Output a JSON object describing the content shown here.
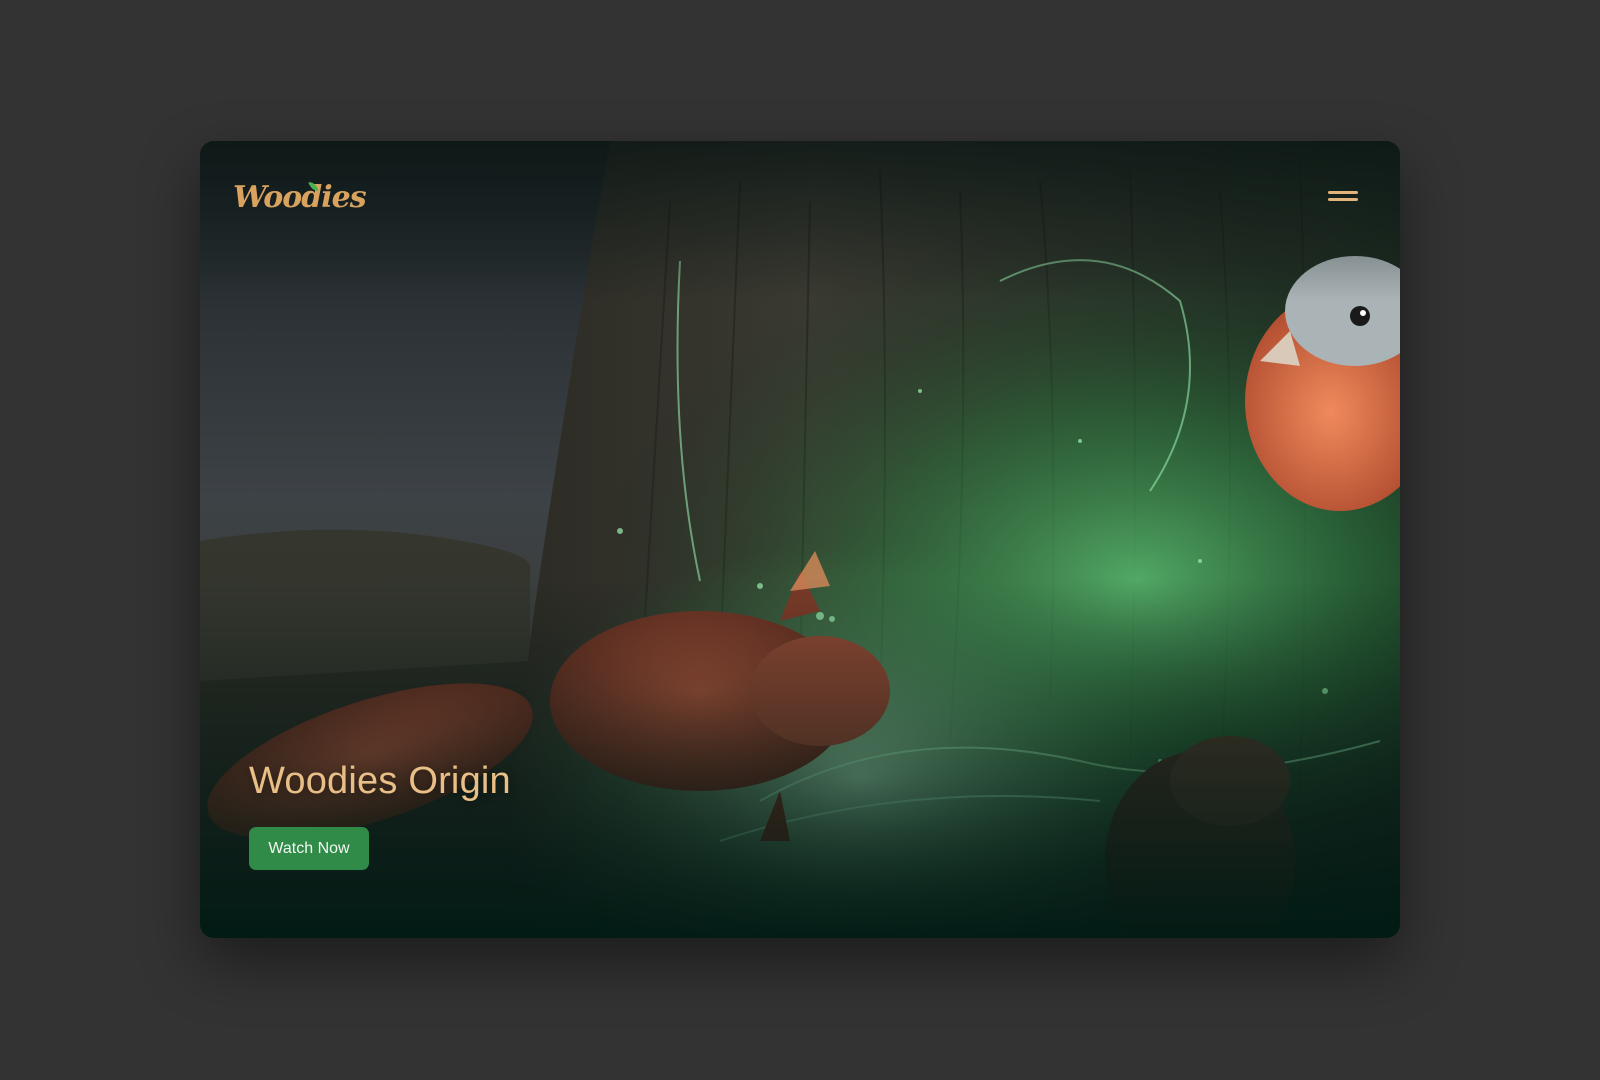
{
  "brand": {
    "logo_text": "Woodies",
    "logo_color": "#d9a35f",
    "leaf_color": "#4caf50"
  },
  "nav": {
    "menu_icon": "hamburger-menu-icon",
    "menu_icon_color": "#e0b47a"
  },
  "hero": {
    "title": "Woodies Origin",
    "title_color": "#e8bf86",
    "cta_label": "Watch Now",
    "cta_color": "#2f8b47"
  },
  "scene": {
    "background_image": "animated forest scene with glowing green tree, squirrel, bird and beaver",
    "glow_color": "#3fc060"
  },
  "page": {
    "background": "#333333"
  }
}
